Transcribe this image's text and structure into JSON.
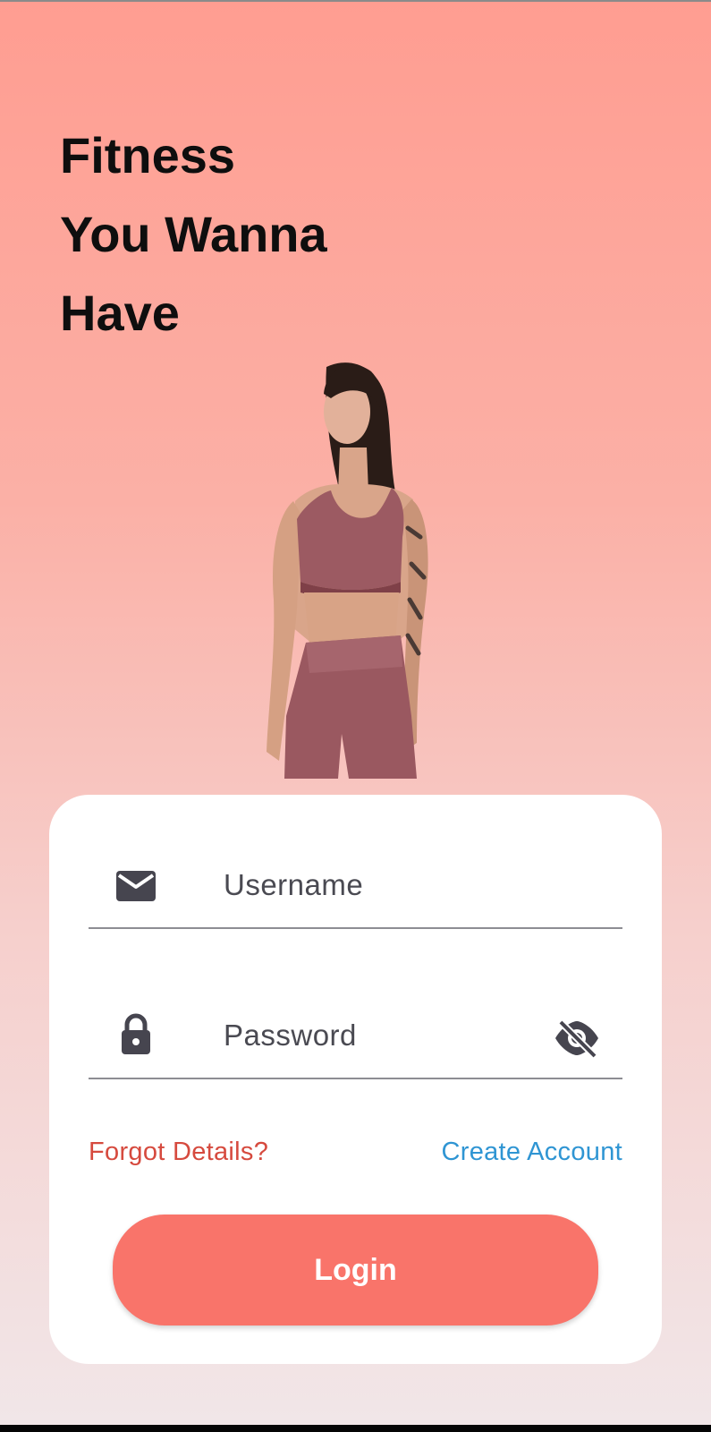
{
  "headline": {
    "line1": "Fitness",
    "line2": "You Wanna",
    "line3": "Have"
  },
  "form": {
    "username_placeholder": "Username",
    "password_placeholder": "Password",
    "forgot_label": "Forgot Details?",
    "create_label": "Create Account",
    "login_label": "Login"
  },
  "icons": {
    "username": "mail-icon",
    "password": "lock-icon",
    "visibility": "eye-off-icon"
  },
  "colors": {
    "accent": "#f9746a",
    "forgot": "#d64a3e",
    "create": "#2f95d3",
    "gradient_top": "#ff9d91",
    "gradient_bottom": "#f1e6e8"
  }
}
